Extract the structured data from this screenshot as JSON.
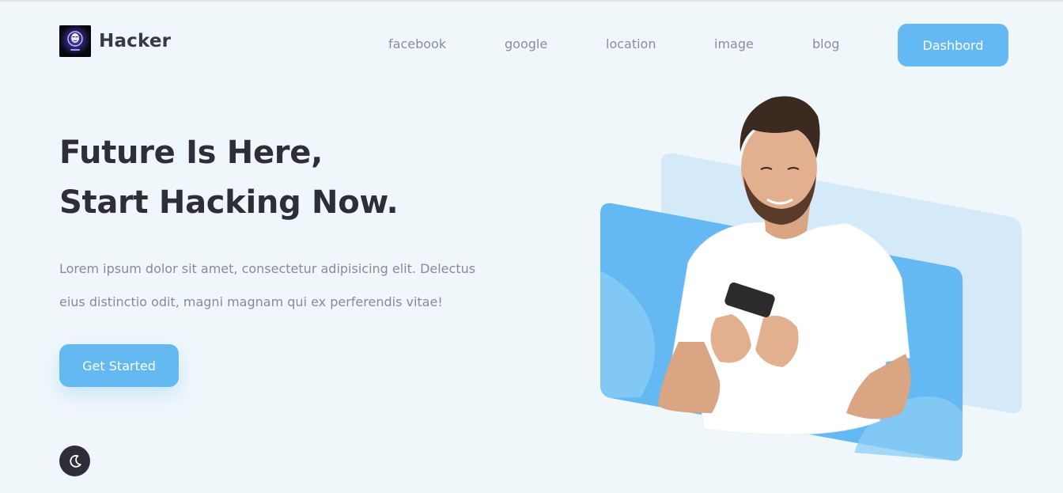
{
  "brand": {
    "name": "Hacker",
    "logo_icon": "hacker-mask-logo"
  },
  "nav": {
    "items": [
      {
        "label": "facebook"
      },
      {
        "label": "google"
      },
      {
        "label": "location"
      },
      {
        "label": "image"
      },
      {
        "label": "blog"
      }
    ],
    "dashboard_label": "Dashbord"
  },
  "hero": {
    "headline_line1": "Future Is Here,",
    "headline_line2": "Start Hacking Now.",
    "description_line1": "Lorem ipsum dolor sit amet, consectetur adipisicing elit. Delectus",
    "description_line2": "eius distinctio odit, magni magnam qui ex perferendis vitae!",
    "cta_label": "Get Started"
  },
  "theme_toggle": {
    "icon": "moon-icon"
  },
  "colors": {
    "background": "#f0f7fb",
    "accent": "#64b9f2",
    "accent_light": "#d5eaf9",
    "heading": "#2f2e38",
    "body_text": "#8a8a92"
  }
}
